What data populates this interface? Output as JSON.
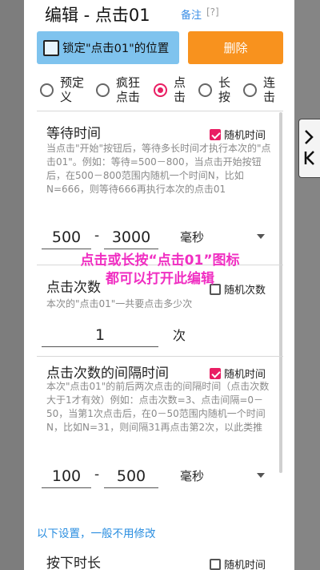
{
  "dialog": {
    "title": "编辑 - 点击01",
    "note_link": "备注",
    "help_link": "[?]",
    "lock_button_label": "锁定\"点击01\"的位置",
    "delete_button_label": "删除",
    "modes": [
      {
        "label": "预定义",
        "checked": false
      },
      {
        "label": "疯狂点击",
        "checked": false
      },
      {
        "label": "点击",
        "checked": true
      },
      {
        "label": "长按",
        "checked": false
      },
      {
        "label": "连击",
        "checked": false
      }
    ]
  },
  "wait_time": {
    "title": "等待时间",
    "random_label": "随机时间",
    "random_checked": true,
    "description": "当点击\"开始\"按钮后，等待多长时间才执行本次的\"点击01\"。例如：等待=500－800，当点击开始按钮后，在500－800范围内随机一个时间N，比如N=666，则等待666再执行本次的点击01",
    "min_value": "500",
    "max_value": "3000",
    "separator": "-",
    "unit": "毫秒"
  },
  "click_count": {
    "title": "点击次数",
    "random_label": "随机次数",
    "random_checked": false,
    "description": "本次的\"点击01\"一共要点击多少次",
    "value": "1",
    "unit": "次"
  },
  "interval": {
    "title": "点击次数的间隔时间",
    "random_label": "随机时间",
    "random_checked": true,
    "description": "本次\"点击01\"的前后两次点击的间隔时间（点击次数大于1才有效）例如：点击次数=3、点击间隔=0－50，当第1次点击后，在0－50范围内随机一个时间N，比如N=31，则间隔31再点击第2次，以此类推",
    "min_value": "100",
    "max_value": "500",
    "separator": "-",
    "unit": "毫秒"
  },
  "advanced_link": "以下设置，一般不用修改",
  "press_duration": {
    "title": "按下时长",
    "random_label": "随机时间",
    "random_checked": false
  },
  "overlay_hint": {
    "line1": "点击或长按“点击01”图标",
    "line2": "都可以打开此编辑"
  },
  "side_tab": {
    "icon": "minimize-arrow-icon"
  },
  "colors": {
    "accent": "#e91e63",
    "lock_button": "#7fc3ee",
    "delete_button": "#f8921e",
    "link": "#2a8ee0",
    "overlay_text": "#f02fc2"
  }
}
